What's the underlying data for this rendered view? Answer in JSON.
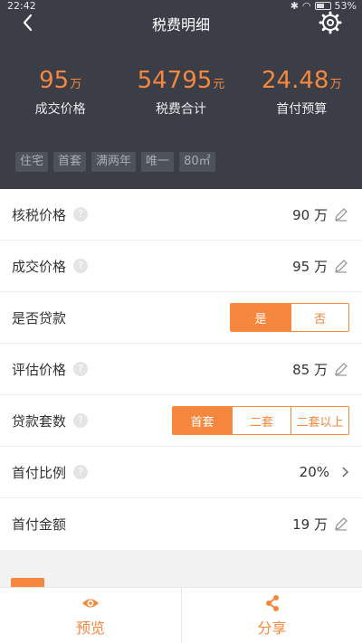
{
  "status": {
    "time": "22:42",
    "battery": "53%"
  },
  "header": {
    "title": "税费明细",
    "summary": [
      {
        "value": "95",
        "unit": "万",
        "label": "成交价格"
      },
      {
        "value": "54795",
        "unit": "元",
        "label": "税费合计"
      },
      {
        "value": "24.48",
        "unit": "万",
        "label": "首付预算"
      }
    ],
    "tags": [
      "住宅",
      "首套",
      "满两年",
      "唯一",
      "80㎡"
    ]
  },
  "rows": {
    "tax_price": {
      "label": "核税价格",
      "value": "90 万"
    },
    "deal_price": {
      "label": "成交价格",
      "value": "95 万"
    },
    "loan": {
      "label": "是否贷款",
      "options": [
        "是",
        "否"
      ],
      "selected": "是"
    },
    "appraisal": {
      "label": "评估价格",
      "value": "85 万"
    },
    "loan_count": {
      "label": "贷款套数",
      "options": [
        "首套",
        "二套",
        "二套以上"
      ],
      "selected": "首套"
    },
    "down_ratio": {
      "label": "首付比例",
      "value": "20%"
    },
    "down_amount": {
      "label": "首付金额",
      "value": "19 万"
    }
  },
  "help_glyph": "?",
  "bottom": {
    "preview": "预览",
    "share": "分享"
  },
  "colors": {
    "accent": "#f5873e",
    "header_bg": "#3b3e47"
  },
  "icons": [
    "back-arrow-icon",
    "gear-icon",
    "help-icon",
    "pencil-icon",
    "chevron-right-icon",
    "eye-icon",
    "share-icon"
  ]
}
